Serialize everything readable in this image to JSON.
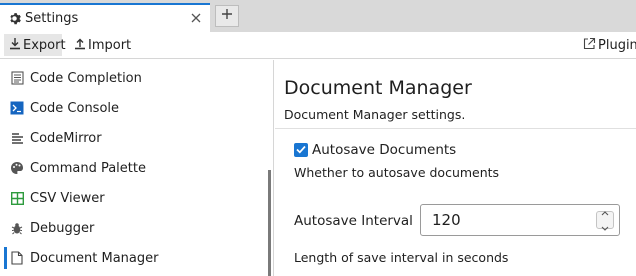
{
  "tabs": [
    {
      "title": "Settings",
      "icon": "gear-icon"
    }
  ],
  "toolbar": {
    "export_label": "Export",
    "import_label": "Import",
    "plugin_label": "Plugin"
  },
  "sidebar": {
    "items": [
      {
        "label": "Code Completion",
        "icon": "list-lines-icon"
      },
      {
        "label": "Code Console",
        "icon": "terminal-icon"
      },
      {
        "label": "CodeMirror",
        "icon": "text-lines-icon"
      },
      {
        "label": "Command Palette",
        "icon": "palette-icon"
      },
      {
        "label": "CSV Viewer",
        "icon": "table-grid-icon"
      },
      {
        "label": "Debugger",
        "icon": "bug-icon"
      },
      {
        "label": "Document Manager",
        "icon": "document-icon",
        "active": true
      }
    ]
  },
  "main": {
    "title": "Document Manager",
    "description": "Document Manager settings.",
    "autosave": {
      "label": "Autosave Documents",
      "checked": true,
      "description": "Whether to autosave documents"
    },
    "interval": {
      "label": "Autosave Interval",
      "value": "120",
      "description": "Length of save interval in seconds"
    }
  },
  "colors": {
    "accent": "#1976d2",
    "tabbar": "#d9d9d9",
    "csv_icon": "#2e9b3e"
  }
}
